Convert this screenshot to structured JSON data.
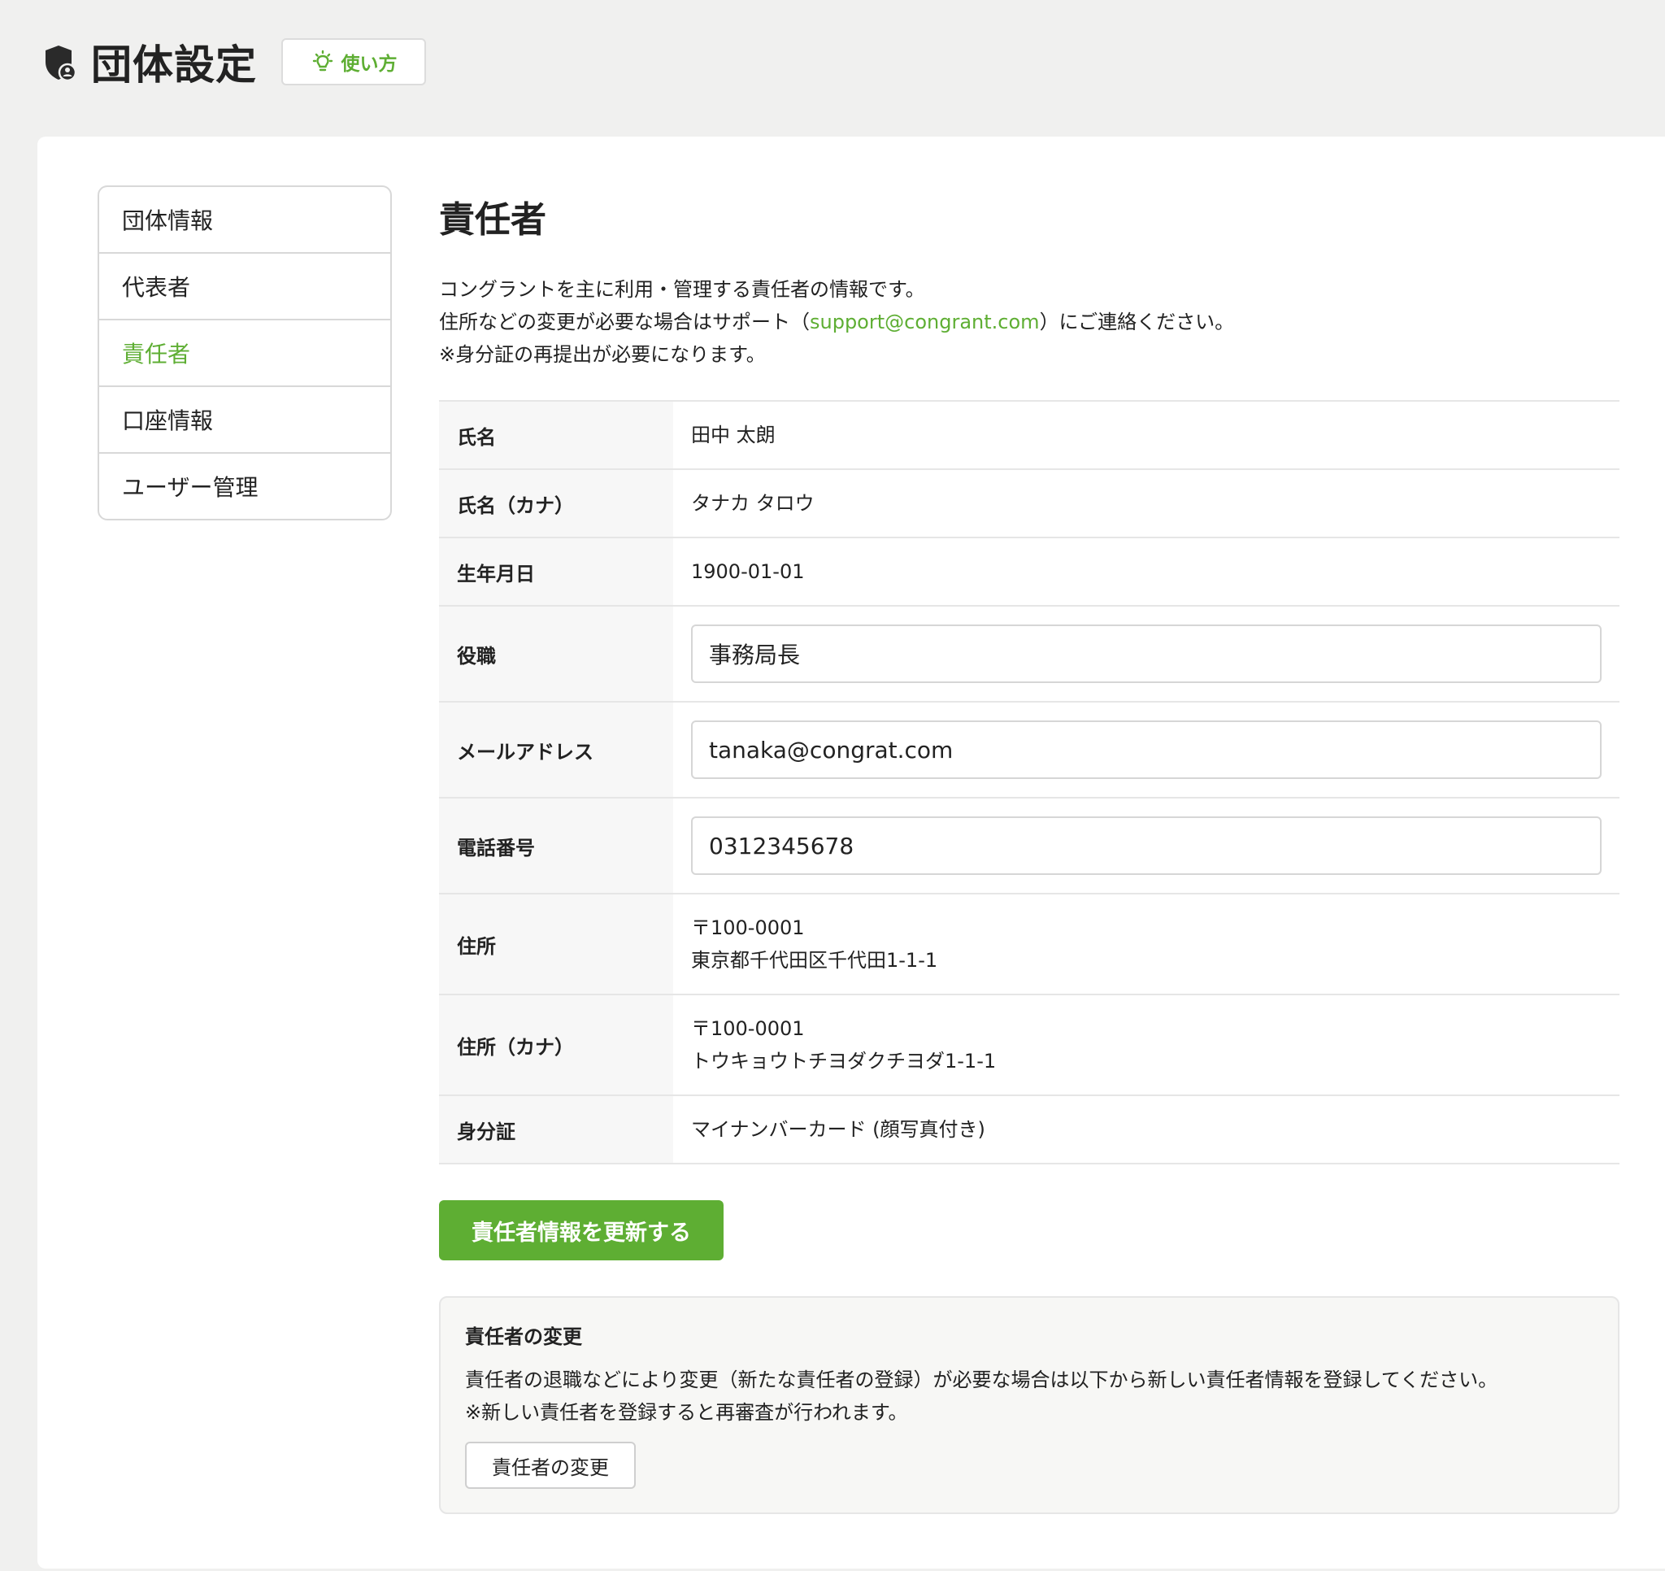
{
  "header": {
    "title": "団体設定",
    "howto_label": "使い方"
  },
  "sidebar": {
    "items": [
      {
        "label": "団体情報"
      },
      {
        "label": "代表者"
      },
      {
        "label": "責任者"
      },
      {
        "label": "口座情報"
      },
      {
        "label": "ユーザー管理"
      }
    ],
    "active": "責任者"
  },
  "main": {
    "title": "責任者",
    "desc_line1": "コングラントを主に利用・管理する責任者の情報です。",
    "desc_line2_pre": "住所などの変更が必要な場合はサポート（",
    "desc_link": "support@congrant.com",
    "desc_line2_post": "）にご連絡ください。",
    "desc_line3": "※身分証の再提出が必要になります。"
  },
  "table": {
    "name_label": "氏名",
    "name_value": "田中 太朗",
    "kana_label": "氏名（カナ）",
    "kana_value": "タナカ タロウ",
    "birth_label": "生年月日",
    "birth_value": "1900-01-01",
    "position_label": "役職",
    "position_value": "事務局長",
    "email_label": "メールアドレス",
    "email_value": "tanaka@congrat.com",
    "phone_label": "電話番号",
    "phone_value": "0312345678",
    "address_label": "住所",
    "address_zip": "〒100-0001",
    "address_line": "東京都千代田区千代田1-1-1",
    "address_kana_label": "住所（カナ）",
    "address_kana_zip": "〒100-0001",
    "address_kana_line": "トウキョウトチヨダクチヨダ1-1-1",
    "id_label": "身分証",
    "id_value": "マイナンバーカード (顔写真付き)"
  },
  "update_button": "責任者情報を更新する",
  "change": {
    "heading": "責任者の変更",
    "line1": "責任者の退職などにより変更（新たな責任者の登録）が必要な場合は以下から新しい責任者情報を登録してください。",
    "line2": "※新しい責任者を登録すると再審査が行われます。",
    "button": "責任者の変更"
  },
  "colors": {
    "accent": "#5eae33",
    "background": "#f0f0ef"
  },
  "icons": {
    "title": "shield-user-icon",
    "howto": "lightbulb-icon"
  }
}
